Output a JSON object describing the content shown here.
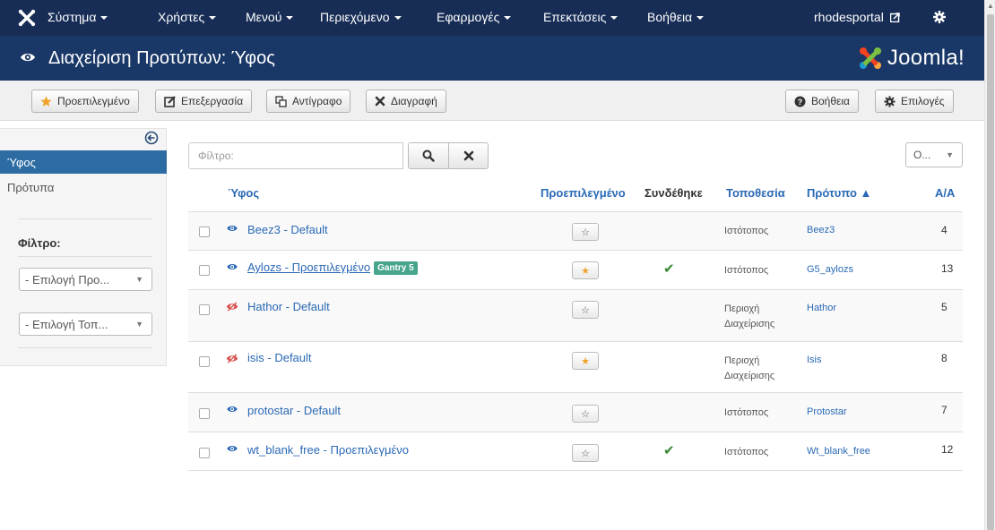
{
  "navbar": {
    "menus": [
      {
        "label": "Σύστημα"
      },
      {
        "label": "Χρήστες"
      },
      {
        "label": "Μενού"
      },
      {
        "label": "Περιεχόμενο"
      },
      {
        "label": "Εφαρμογές"
      },
      {
        "label": "Επεκτάσεις"
      },
      {
        "label": "Βοήθεια"
      }
    ],
    "site_link": "rhodesportal",
    "icons": {
      "logo": "joomla-x-icon",
      "external": "external-link-icon",
      "settings": "gear-icon"
    }
  },
  "header": {
    "title": "Διαχείριση Προτύπων: Ύφος",
    "icon": "eye-icon",
    "brand": "Joomla!",
    "brand_colors": [
      "#f44321",
      "#7ac143",
      "#1c9ad6",
      "#f9a541"
    ]
  },
  "toolbar": {
    "default_label": "Προεπιλεγμένο",
    "edit_label": "Επεξεργασία",
    "copy_label": "Αντίγραφο",
    "delete_label": "Διαγραφή",
    "help_label": "Βοήθεια",
    "options_label": "Επιλογές"
  },
  "sidebar": {
    "items": [
      {
        "label": "Ύφος",
        "active": true
      },
      {
        "label": "Πρότυπα",
        "active": false
      }
    ],
    "filter_title": "Φίλτρο:",
    "select_template": "- Επιλογή Προ...",
    "select_location": "- Επιλογή Τοπ..."
  },
  "filter": {
    "placeholder": "Φίλτρο:",
    "order_value": "Ο..."
  },
  "table": {
    "headers": {
      "style": "Ύφος",
      "default": "Προεπιλεγμένο",
      "assigned": "Συνδέθηκε",
      "location": "Τοποθεσία",
      "template": "Πρότυπο ▲",
      "id": "Α/Α"
    },
    "rows": [
      {
        "name": "Beez3 - Default",
        "icon": "eye-icon",
        "default": false,
        "assigned": false,
        "location_1": "Ιστότοπος",
        "location_2": "",
        "template": "Beez3",
        "id": "4"
      },
      {
        "name": "Aylozs - Προεπιλεγμένο",
        "badge": "Gantry 5",
        "icon": "eye-icon",
        "default": true,
        "assigned": true,
        "location_1": "Ιστότοπος",
        "location_2": "",
        "template": "G5_aylozs",
        "id": "13"
      },
      {
        "name": "Hathor - Default",
        "icon": "eye-slash-icon",
        "default": false,
        "assigned": false,
        "location_1": "Περιοχή",
        "location_2": "Διαχείρισης",
        "template": "Hathor",
        "id": "5"
      },
      {
        "name": "isis - Default",
        "icon": "eye-slash-icon",
        "default": true,
        "assigned": false,
        "location_1": "Περιοχή",
        "location_2": "Διαχείρισης",
        "template": "Isis",
        "id": "8"
      },
      {
        "name": "protostar - Default",
        "icon": "eye-icon",
        "default": false,
        "assigned": false,
        "location_1": "Ιστότοπος",
        "location_2": "",
        "template": "Protostar",
        "id": "7"
      },
      {
        "name": "wt_blank_free - Προεπιλεγμένο",
        "icon": "eye-icon",
        "default": false,
        "assigned": true,
        "location_1": "Ιστότοπος",
        "location_2": "",
        "template": "Wt_blank_free",
        "id": "12"
      }
    ]
  },
  "colors": {
    "navbar": "#172d56",
    "header": "#1a3867",
    "link": "#2a69b5",
    "active_sidebar": "#2d6ca2",
    "check": "#36872f",
    "star": "#f0a32a",
    "badge": "#47a48d"
  }
}
